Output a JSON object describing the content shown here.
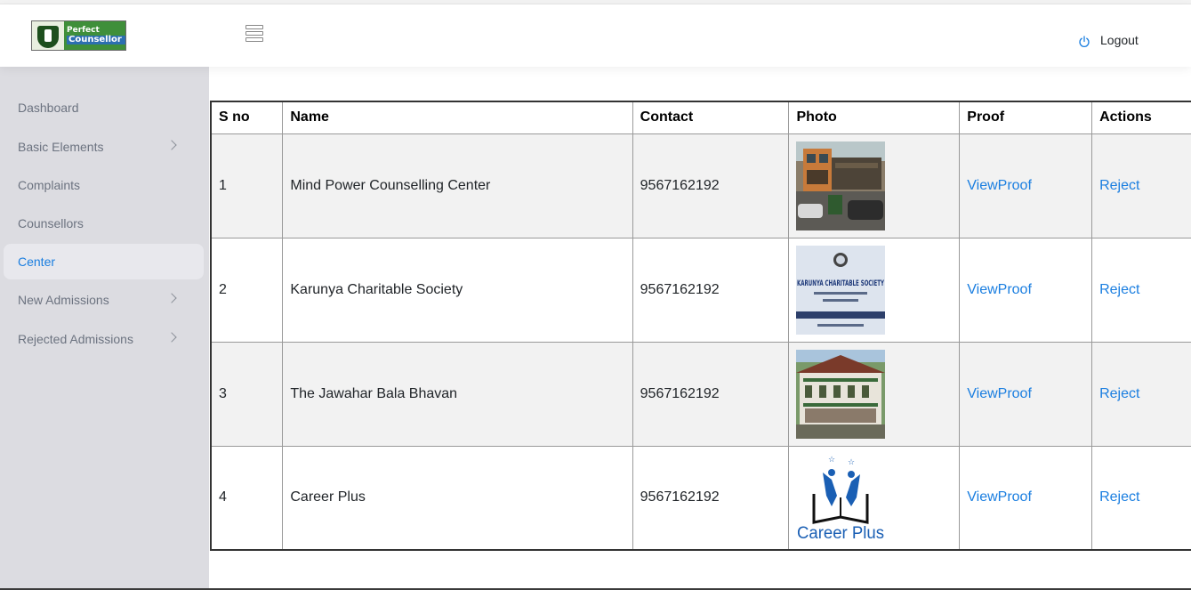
{
  "brand": {
    "line1": "Perfect",
    "line2": "Counsellor"
  },
  "header": {
    "logout_label": "Logout"
  },
  "sidebar": {
    "items": [
      {
        "label": "Dashboard",
        "has_submenu": false,
        "active": false
      },
      {
        "label": "Basic Elements",
        "has_submenu": true,
        "active": false
      },
      {
        "label": "Complaints",
        "has_submenu": false,
        "active": false
      },
      {
        "label": "Counsellors",
        "has_submenu": false,
        "active": false
      },
      {
        "label": "Center",
        "has_submenu": false,
        "active": true
      },
      {
        "label": "New Admissions",
        "has_submenu": true,
        "active": false
      },
      {
        "label": "Rejected Admissions",
        "has_submenu": true,
        "active": false
      }
    ]
  },
  "table": {
    "headers": [
      "S no",
      "Name",
      "Contact",
      "Photo",
      "Proof",
      "Actions"
    ],
    "rows": [
      {
        "sno": "1",
        "name": "Mind Power Counselling Center",
        "contact": "9567162192",
        "photo_icon": "building-photo",
        "proof": "ViewProof",
        "action": "Reject"
      },
      {
        "sno": "2",
        "name": "Karunya Charitable Society",
        "contact": "9567162192",
        "photo_icon": "signboard-photo",
        "proof": "ViewProof",
        "action": "Reject",
        "photo_text": "KARUNYA CHARITABLE SOCIETY"
      },
      {
        "sno": "3",
        "name": "The Jawahar Bala Bhavan",
        "contact": "9567162192",
        "photo_icon": "building-photo",
        "proof": "ViewProof",
        "action": "Reject"
      },
      {
        "sno": "4",
        "name": "Career Plus",
        "contact": "9567162192",
        "photo_icon": "logo-photo",
        "proof": "ViewProof",
        "action": "Reject",
        "photo_text": "Career Plus"
      }
    ]
  },
  "colors": {
    "accent": "#1a7ee0",
    "sidebar_bg": "#dcdce1",
    "brand_green": "#3f8f3a"
  }
}
